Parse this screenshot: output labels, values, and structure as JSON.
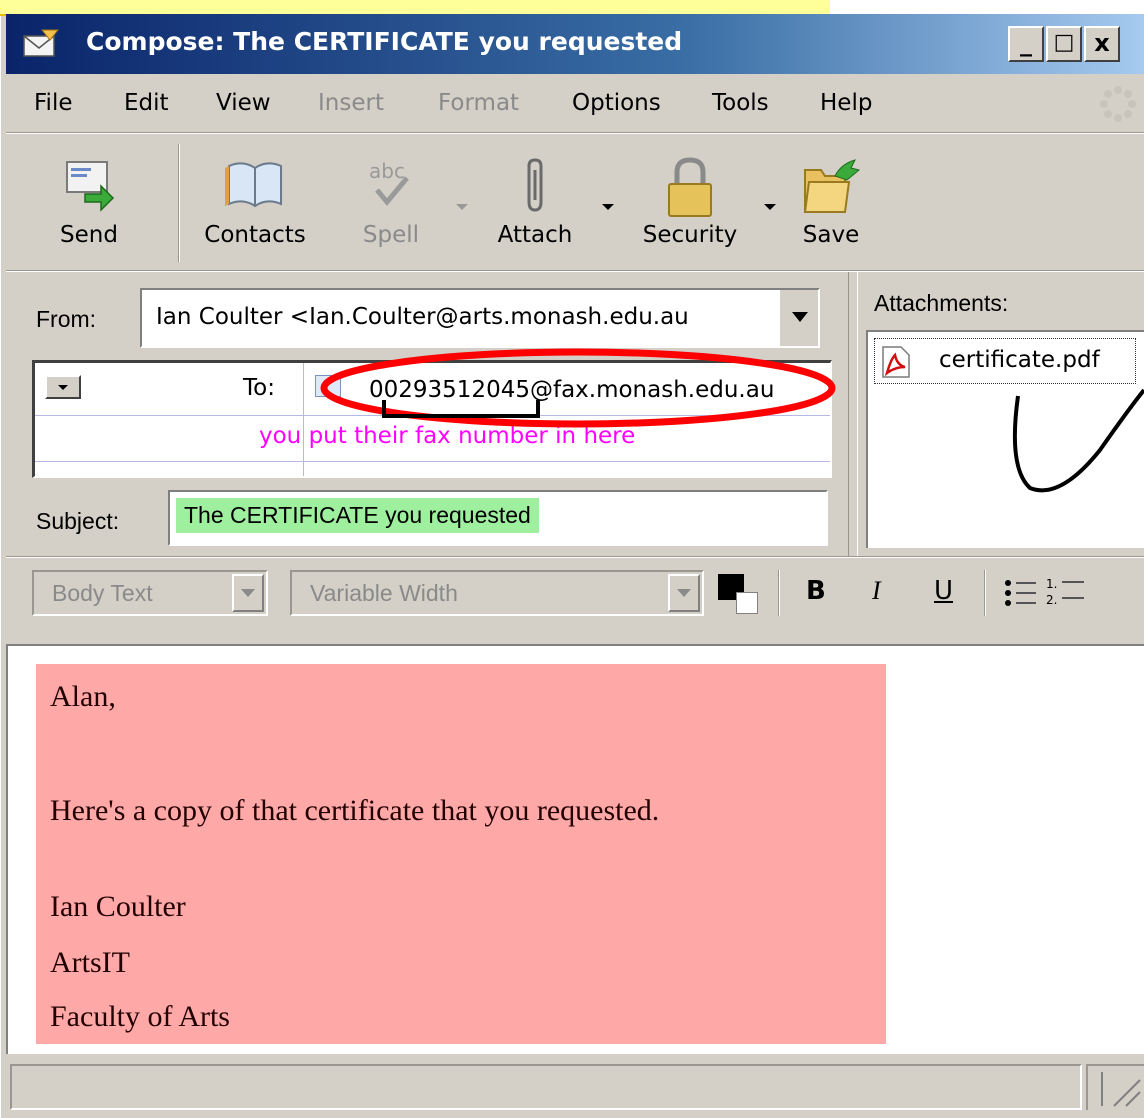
{
  "window": {
    "title": "Compose: The CERTIFICATE you requested",
    "buttons": [
      "_",
      "□",
      "x"
    ]
  },
  "menu": [
    {
      "label": "File",
      "enabled": true
    },
    {
      "label": "Edit",
      "enabled": true
    },
    {
      "label": "View",
      "enabled": true
    },
    {
      "label": "Insert",
      "enabled": false
    },
    {
      "label": "Format",
      "enabled": false
    },
    {
      "label": "Options",
      "enabled": true
    },
    {
      "label": "Tools",
      "enabled": true
    },
    {
      "label": "Help",
      "enabled": true
    }
  ],
  "toolbar": {
    "send": "Send",
    "contacts": "Contacts",
    "spell": "Spell",
    "attach": "Attach",
    "security": "Security",
    "save": "Save"
  },
  "headers": {
    "from_label": "From:",
    "from_value": "Ian Coulter <Ian.Coulter@arts.monash.edu.au",
    "to_label": "To:",
    "to_value": "00293512045@fax.monash.edu.au",
    "subject_label": "Subject:",
    "subject_value": "The CERTIFICATE you requested"
  },
  "annotation": {
    "hint": "you put their fax number in here",
    "color": "#ff00ff",
    "circle_color": "#ff0000"
  },
  "attachments": {
    "label": "Attachments:",
    "items": [
      "certificate.pdf"
    ]
  },
  "format_bar": {
    "paragraph": "Body Text",
    "font": "Variable Width",
    "bold": "B",
    "italic": "I",
    "underline": "U"
  },
  "body": {
    "highlight_color": "#ffa8a8",
    "lines": [
      "Alan,",
      "",
      "Here's a copy of that certificate that you requested.",
      "",
      "Ian Coulter",
      "ArtsIT",
      "Faculty of Arts"
    ]
  }
}
